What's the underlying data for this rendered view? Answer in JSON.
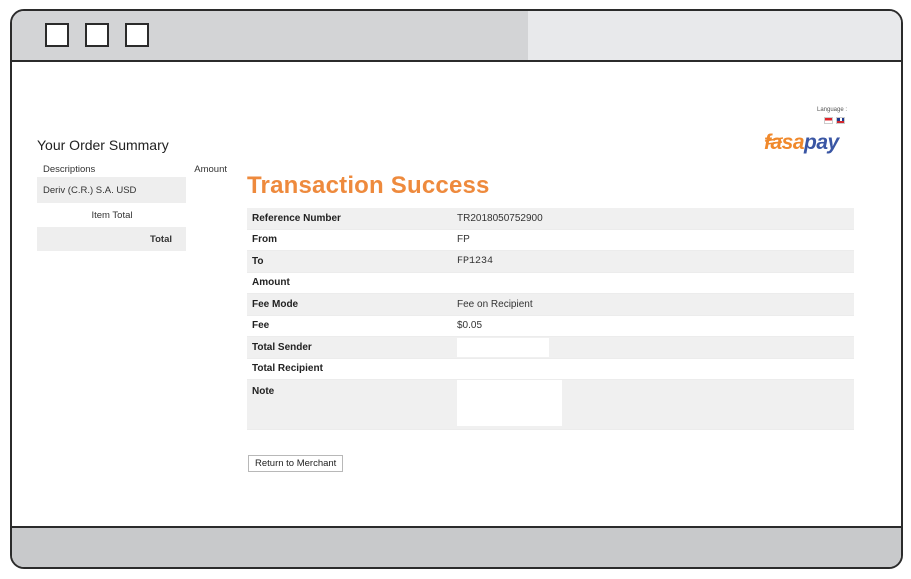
{
  "order_summary": {
    "title": "Your Order Summary",
    "col_descriptions": "Descriptions",
    "col_amount": "Amount",
    "item_description": "Deriv (C.R.) S.A. USD",
    "item_total_label": "Item Total",
    "total_label": "Total"
  },
  "language": {
    "label": "Language :"
  },
  "logo": {
    "part1": "fasa",
    "part2": "pay"
  },
  "transaction": {
    "title": "Transaction Success",
    "rows": [
      {
        "label": "Reference Number",
        "value": "TR2018050752900"
      },
      {
        "label": "From",
        "value": "FP"
      },
      {
        "label": "To",
        "value": "FP1234"
      },
      {
        "label": "Amount",
        "value": ""
      },
      {
        "label": "Fee Mode",
        "value": "Fee on Recipient"
      },
      {
        "label": "Fee",
        "value": "$0.05"
      },
      {
        "label": "Total Sender",
        "value": ""
      },
      {
        "label": "Total Recipient",
        "value": ""
      },
      {
        "label": "Note",
        "value": ""
      }
    ]
  },
  "actions": {
    "return_label": "Return to Merchant"
  },
  "colors": {
    "accent_orange": "#ee8a3d",
    "logo_blue": "#3a56a4"
  }
}
